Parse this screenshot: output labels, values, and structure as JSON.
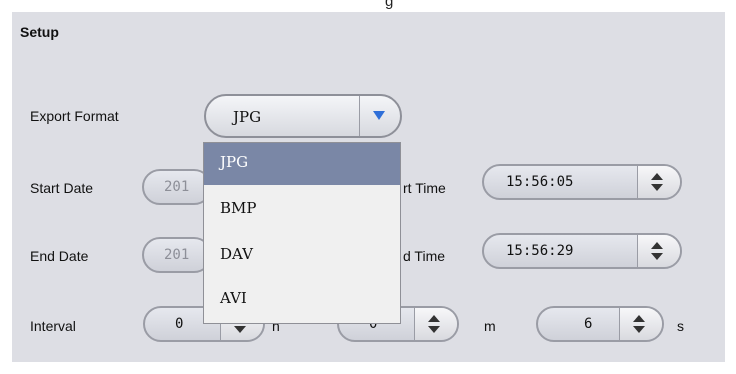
{
  "top_fragment": "g",
  "section_title": "Setup",
  "labels": {
    "export_format": "Export Format",
    "start_date": "Start Date",
    "end_date": "End Date",
    "interval": "Interval",
    "start_time": "rt Time",
    "end_time": "d Time",
    "unit_h": "h",
    "unit_m": "m",
    "unit_s": "s"
  },
  "export_format": {
    "selected": "JPG",
    "options": [
      "JPG",
      "BMP",
      "DAV",
      "AVI"
    ]
  },
  "start_date_value": "201",
  "end_date_value": "201",
  "start_time_value": "15:56:05",
  "end_time_value": "15:56:29",
  "interval": {
    "hours": "0",
    "minutes": "0",
    "seconds": "6"
  },
  "icons": {
    "dropdown_arrow": "triangle-down-icon",
    "spinner": "up-down-arrows-icon"
  },
  "colors": {
    "panel_bg": "#dddee4",
    "dropdown_selected_bg": "#7a87a6",
    "arrow_blue": "#2f6fd8"
  }
}
